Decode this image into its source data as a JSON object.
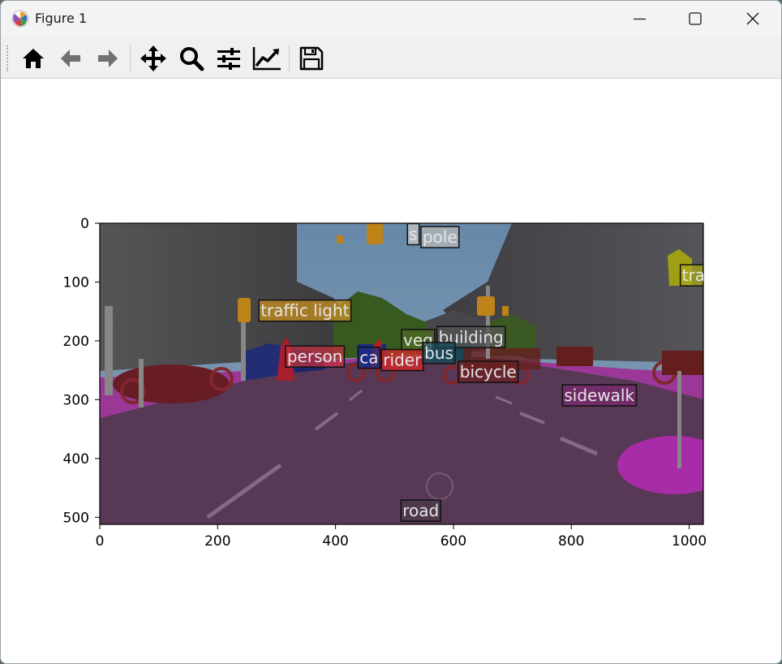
{
  "window": {
    "title": "Figure 1",
    "app_icon": "matplotlib-icon"
  },
  "controls": {
    "minimize": "minimize-icon",
    "maximize": "maximize-icon",
    "close": "close-icon"
  },
  "toolbar": {
    "buttons": [
      {
        "name": "home-button",
        "icon": "home-icon"
      },
      {
        "name": "back-button",
        "icon": "arrow-left-icon"
      },
      {
        "name": "forward-button",
        "icon": "arrow-right-icon"
      },
      {
        "name": "pan-button",
        "icon": "move-icon"
      },
      {
        "name": "zoom-button",
        "icon": "magnifier-icon"
      },
      {
        "name": "configure-subplots-button",
        "icon": "sliders-icon"
      },
      {
        "name": "edit-axes-button",
        "icon": "line-chart-icon"
      },
      {
        "name": "save-button",
        "icon": "floppy-disk-icon"
      }
    ]
  },
  "chart_data": {
    "type": "image",
    "xlim": [
      0,
      1024
    ],
    "ylim": [
      512,
      0
    ],
    "xticks": [
      "0",
      "200",
      "400",
      "600",
      "800",
      "1000"
    ],
    "yticks": [
      "0",
      "100",
      "200",
      "300",
      "400",
      "500"
    ],
    "labels": [
      {
        "text": "s",
        "x": 522,
        "y": 20,
        "color": "#c7c7c7"
      },
      {
        "text": "pole",
        "x": 545,
        "y": 25,
        "color": "#b8b8b8"
      },
      {
        "text": "traffic light",
        "x": 270,
        "y": 150,
        "color": "#c89020"
      },
      {
        "text": "tra",
        "x": 985,
        "y": 90,
        "color": "#a8a818"
      },
      {
        "text": "veg",
        "x": 512,
        "y": 200,
        "color": "#4d6a22"
      },
      {
        "text": "building",
        "x": 572,
        "y": 195,
        "color": "#555555"
      },
      {
        "text": "person",
        "x": 315,
        "y": 228,
        "color": "#c03040"
      },
      {
        "text": "ca",
        "x": 438,
        "y": 230,
        "color": "#1e2c88"
      },
      {
        "text": "rider",
        "x": 478,
        "y": 234,
        "color": "#d82a2a"
      },
      {
        "text": "bus",
        "x": 548,
        "y": 222,
        "color": "#1a4a5a"
      },
      {
        "text": "bicycle",
        "x": 608,
        "y": 254,
        "color": "#6a2020"
      },
      {
        "text": "sidewalk",
        "x": 785,
        "y": 294,
        "color": "#7a2a70"
      },
      {
        "text": "road",
        "x": 511,
        "y": 490,
        "color": "#4a3a4a"
      }
    ]
  }
}
